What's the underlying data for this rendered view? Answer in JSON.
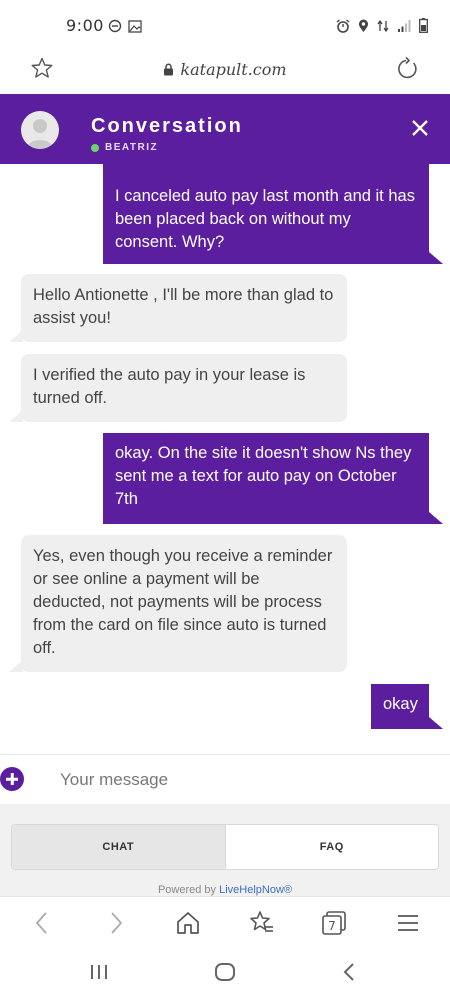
{
  "status_bar": {
    "time": "9:00"
  },
  "browser": {
    "url": "katapult.com"
  },
  "conversation": {
    "title": "Conversation",
    "agent_name": "BEATRIZ",
    "colors": {
      "brand": "#5b1e9f",
      "agent_bubble": "#efefef",
      "online": "#6ed36e"
    }
  },
  "messages": [
    {
      "sender": "user",
      "text": "I canceled auto pay last month and it has been placed back on without my consent. Why?"
    },
    {
      "sender": "agent",
      "text": "Hello Antionette , I'll be more than glad to assist you!"
    },
    {
      "sender": "agent",
      "text": "I verified the auto pay in your lease is turned off."
    },
    {
      "sender": "user",
      "text": "okay. On the site it doesn't show Ns they sent me a text for auto pay on October 7th"
    },
    {
      "sender": "agent",
      "text": "Yes, even though you receive a reminder or see online a payment will be deducted, not payments will be process from the card on file since auto is turned off."
    },
    {
      "sender": "user",
      "text": "okay"
    }
  ],
  "composer": {
    "placeholder": "Your message"
  },
  "tabs": {
    "chat": "CHAT",
    "faq": "FAQ",
    "active": "chat"
  },
  "footer": {
    "powered_by": "Powered by ",
    "provider": "LiveHelpNow®"
  },
  "browser_toolbar": {
    "tab_count": "7"
  }
}
